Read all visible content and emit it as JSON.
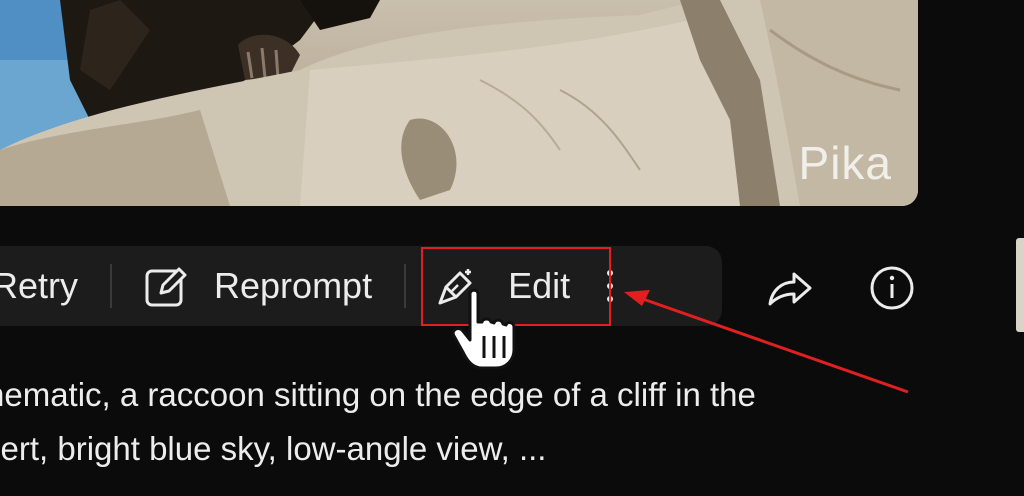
{
  "video": {
    "watermark": "Pika"
  },
  "toolbar": {
    "retry_label": "Retry",
    "reprompt_label": "Reprompt",
    "edit_label": "Edit"
  },
  "prompt": {
    "line1": "nematic, a raccoon sitting on the edge of a cliff in the",
    "line2": "sert, bright blue sky, low-angle view, ..."
  },
  "annotation": {
    "highlight_color": "#e02020"
  },
  "colors": {
    "background": "#0b0b0b",
    "toolbar": "#1c1c1c",
    "text": "#ececec"
  }
}
